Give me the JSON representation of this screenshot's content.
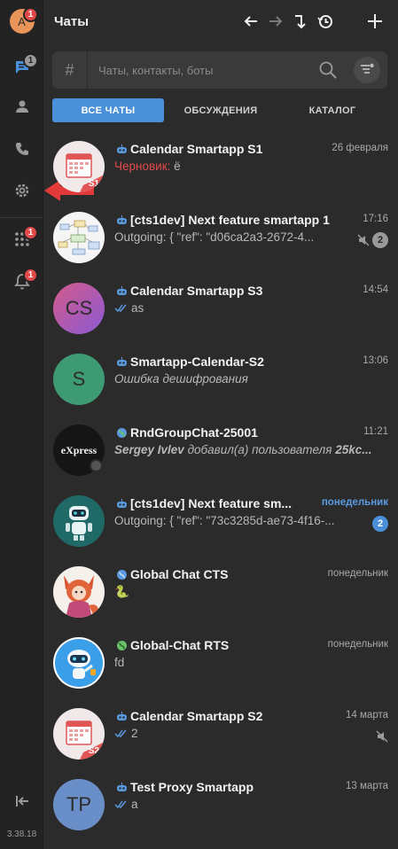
{
  "colors": {
    "accent": "#4a90d9",
    "badge_red": "#e24a4a",
    "background": "#2b2b2b",
    "rail": "#232323"
  },
  "rail": {
    "avatar_letter": "A",
    "avatar_badge": "1",
    "chats_badge": "1",
    "apps_badge": "1",
    "notifications_badge": "1",
    "version": "3.38.18"
  },
  "header": {
    "title": "Чаты"
  },
  "search": {
    "placeholder": "Чаты, контакты, боты",
    "hash": "#"
  },
  "tabs": [
    {
      "label": "ВСЕ ЧАТЫ",
      "active": true
    },
    {
      "label": "ОБСУЖДЕНИЯ",
      "active": false
    },
    {
      "label": "КАТАЛОГ",
      "active": false
    }
  ],
  "chats": [
    {
      "title": "Calendar Smartapp S1",
      "time": "26 февраля",
      "draft_label": "Черновик:",
      "preview": "ё",
      "avatar": "calendar",
      "avatar_label": "S1",
      "type": "bot"
    },
    {
      "title": "[cts1dev] Next feature smartapp 1",
      "time": "17:16",
      "preview": "Outgoing: { \"ref\": \"d06ca2a3-2672-4...",
      "muted": true,
      "unread": "2",
      "avatar": "diagram",
      "type": "bot"
    },
    {
      "title": "Calendar Smartapp S3",
      "time": "14:54",
      "preview": "as",
      "read": true,
      "avatar": "initials",
      "avatar_label": "CS",
      "type": "bot"
    },
    {
      "title": "Smartapp-Calendar-S2",
      "time": "13:06",
      "preview": "Ошибка дешифрования",
      "italic": true,
      "avatar": "initials",
      "avatar_label": "S",
      "type": "bot"
    },
    {
      "title": "RndGroupChat-25001",
      "time": "11:21",
      "preview_author": "Sergey Ivlev",
      "preview": "добавил(а) пользователя",
      "preview_tail": "25kc...",
      "italic": true,
      "avatar": "express",
      "avatar_label": "eXpress",
      "type": "group"
    },
    {
      "title": "[cts1dev] Next feature sm...",
      "time": "понедельник",
      "time_blue": true,
      "preview": "Outgoing: { \"ref\": \"73c3285d-ae73-4f16-...",
      "unread": "2",
      "unread_blue": true,
      "avatar": "robot",
      "type": "bot"
    },
    {
      "title": "Global Chat CTS",
      "time": "понедельник",
      "preview": "🐍",
      "avatar": "fox",
      "type": "global"
    },
    {
      "title": "Global-Chat RTS",
      "time": "понедельник",
      "preview": "fd",
      "avatar": "robot2",
      "type": "global-green"
    },
    {
      "title": "Calendar Smartapp S2",
      "time": "14 марта",
      "preview": "2",
      "read": true,
      "muted": true,
      "avatar": "calendar",
      "avatar_label": "S2",
      "type": "bot"
    },
    {
      "title": "Test Proxy Smartapp",
      "time": "13 марта",
      "preview": "a",
      "read": true,
      "avatar": "initials",
      "avatar_label": "TP",
      "type": "bot"
    }
  ]
}
